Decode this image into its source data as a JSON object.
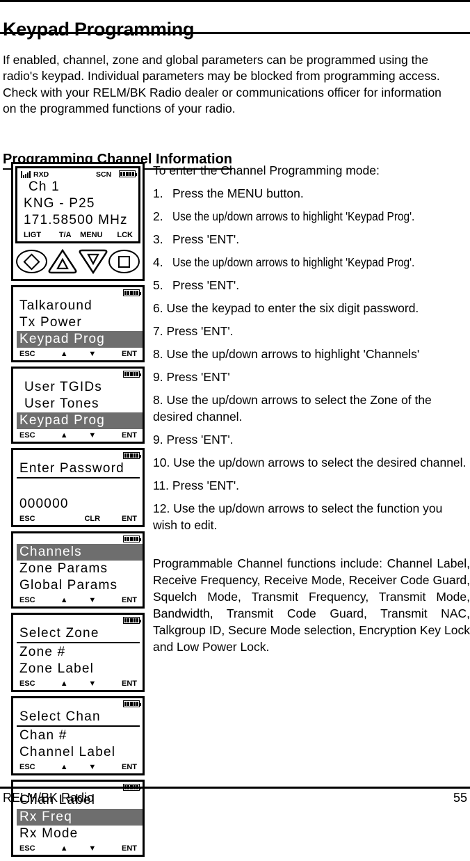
{
  "document": {
    "title": "Keypad Programming",
    "intro": "If enabled, channel, zone and global parameters can be programmed using the radio's keypad. Individual parameters may be blocked from programming access. Check with your RELM/BK Radio dealer or communications officer for information on the programmed functions of your radio.",
    "section_heading": "Programming Channel Information"
  },
  "radio_screens": [
    {
      "name": "home-display",
      "status": {
        "signal_icon": "signal-bars-icon",
        "rxd": "RXD",
        "scn": "SCN",
        "battery_icon": "battery-icon"
      },
      "lines": [
        {
          "text": "Ch 1",
          "style": "normal"
        },
        {
          "text": "KNG - P25",
          "style": "normal"
        },
        {
          "text": "171.58500 MHz",
          "style": "normal"
        }
      ],
      "softkeys": [
        "LIGT",
        "T/A",
        "MENU",
        "LCK"
      ],
      "keypad": [
        "diamond-button",
        "up-arrow-button",
        "down-arrow-button",
        "square-button"
      ]
    },
    {
      "name": "menu-talkaround",
      "lines": [
        {
          "text": "Talkaround",
          "style": "normal"
        },
        {
          "text": "Tx Power",
          "style": "normal"
        },
        {
          "text": "Keypad Prog",
          "style": "highlight"
        }
      ],
      "softkeys": [
        "ESC",
        "▲",
        "▼",
        "ENT"
      ]
    },
    {
      "name": "menu-user-tgids",
      "lines": [
        {
          "text": "User TGIDs",
          "style": "normal"
        },
        {
          "text": "User Tones",
          "style": "normal"
        },
        {
          "text": "Keypad Prog",
          "style": "highlight"
        }
      ],
      "softkeys": [
        "ESC",
        "▲",
        "▼",
        "ENT"
      ]
    },
    {
      "name": "enter-password",
      "lines": [
        {
          "text": "Enter Password",
          "style": "underline"
        },
        {
          "text": "",
          "style": "blank"
        },
        {
          "text": "000000",
          "style": "normal"
        }
      ],
      "softkeys": [
        "ESC",
        "",
        "CLR",
        "ENT"
      ]
    },
    {
      "name": "menu-channels",
      "lines": [
        {
          "text": "Channels",
          "style": "highlight"
        },
        {
          "text": "Zone Params",
          "style": "normal"
        },
        {
          "text": "Global Params",
          "style": "normal"
        }
      ],
      "softkeys": [
        "ESC",
        "▲",
        "▼",
        "ENT"
      ]
    },
    {
      "name": "select-zone",
      "lines": [
        {
          "text": "Select Zone",
          "style": "underline"
        },
        {
          "text": "Zone #",
          "style": "normal"
        },
        {
          "text": "Zone Label",
          "style": "normal"
        }
      ],
      "softkeys": [
        "ESC",
        "▲",
        "▼",
        "ENT"
      ]
    },
    {
      "name": "select-chan",
      "lines": [
        {
          "text": "Select Chan",
          "style": "underline"
        },
        {
          "text": "Chan #",
          "style": "normal"
        },
        {
          "text": "Channel Label",
          "style": "normal"
        }
      ],
      "softkeys": [
        "ESC",
        "▲",
        "▼",
        "ENT"
      ]
    },
    {
      "name": "chan-label",
      "lines": [
        {
          "text": "Chan Label",
          "style": "normal"
        },
        {
          "text": "Rx Freq",
          "style": "highlight"
        },
        {
          "text": "Rx Mode",
          "style": "normal"
        }
      ],
      "softkeys": [
        "ESC",
        "▲",
        "▼",
        "ENT"
      ]
    }
  ],
  "instructions": {
    "lead": "To enter the Channel Programming mode:",
    "steps": [
      {
        "num": "1.",
        "text": "Press the MENU button.",
        "narrow": false
      },
      {
        "num": "2.",
        "text": "Use the up/down arrows to highlight 'Keypad Prog'.",
        "narrow": true
      },
      {
        "num": "3.",
        "text": "Press 'ENT'.",
        "narrow": false
      },
      {
        "num": "4.",
        "text": "Use the up/down arrows to highlight 'Keypad Prog'.",
        "narrow": true
      },
      {
        "num": "5.",
        "text": "Press 'ENT'.",
        "narrow": false
      }
    ],
    "paras": [
      "6.  Use the keypad to enter the six digit password.",
      "7.   Press 'ENT'.",
      "8.  Use the up/down arrows to highlight 'Channels'",
      "9.   Press 'ENT'",
      "8.  Use the up/down arrows to select the Zone of the desired channel.",
      "9.   Press 'ENT'.",
      "10.  Use the up/down arrows to select the desired channel.",
      "11.  Press 'ENT'.",
      "12.  Use the up/down arrows to select the function you wish to edit."
    ],
    "final": "Programmable Channel functions include: Channel Label, Receive Frequency, Receive Mode, Receiver Code Guard, Squelch Mode, Transmit Frequency, Transmit Mode, Bandwidth, Transmit Code Guard, Transmit NAC, Talkgroup ID, Secure Mode selection, Encryption Key Lock and Low Power Lock."
  },
  "footer": {
    "left": "RELM/BK Radio",
    "page_number": "55"
  }
}
